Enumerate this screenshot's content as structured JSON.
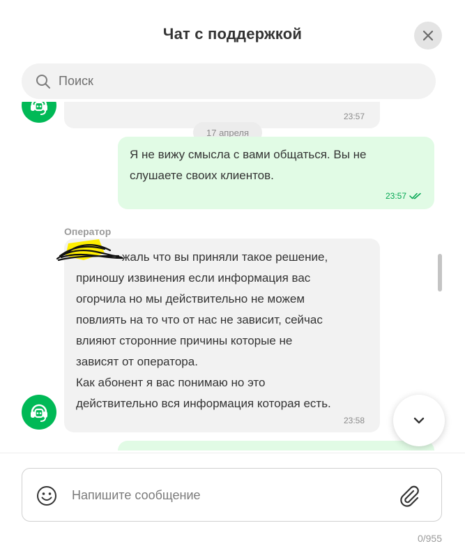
{
  "header": {
    "title": "Чат с поддержкой"
  },
  "search": {
    "placeholder": "Поиск"
  },
  "messages": {
    "prev_incoming_time": "23:57",
    "date_divider": "17 апреля",
    "outgoing_1": {
      "text": "Я не вижу смысла с вами общаться. Вы не\nслушаете своих клиентов.",
      "time": "23:57",
      "status": "read"
    },
    "incoming_1": {
      "sender": "Оператор",
      "text": "жаль что вы приняли такое решение,\nприношу извинения если информация вас\nогорчила но мы действительно не можем\nповлиять на то что от нас не зависит, сейчас\nвлияют сторонние причины которые не\nзависят от оператора.\nКак абонент я вас понимаю но это\nдействительно вся информация которая есть.",
      "time": "23:58"
    }
  },
  "composer": {
    "placeholder": "Напишите сообщение",
    "char_counter": "0/955"
  },
  "icons": {
    "close": "close-icon",
    "search": "search-icon",
    "avatar": "operator-headset-icon",
    "read_status": "double-check-icon",
    "scroll_down": "chevron-down-icon",
    "emoji": "emoji-icon",
    "attach": "paperclip-icon"
  },
  "colors": {
    "brand_green": "#00b956",
    "outgoing_bubble": "#e1fbe5",
    "incoming_bubble": "#f2f2f2",
    "read_check": "#00a550",
    "redaction_highlight": "#ffee00"
  }
}
